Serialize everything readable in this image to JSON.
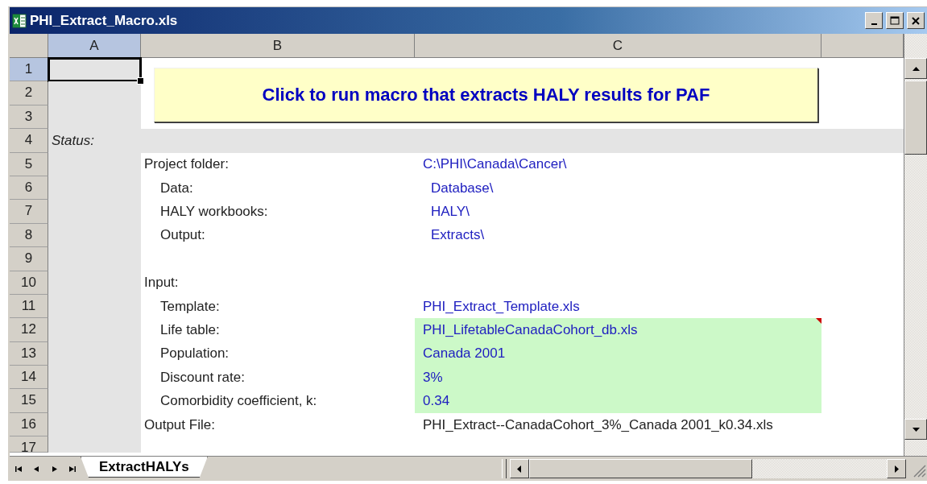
{
  "window": {
    "title": "PHI_Extract_Macro.xls"
  },
  "columns": [
    {
      "label": "A",
      "selected": true
    },
    {
      "label": "B",
      "selected": false
    },
    {
      "label": "C",
      "selected": false
    }
  ],
  "macro_button": {
    "label": "Click to run macro that extracts HALY results for PAF"
  },
  "rows": [
    {
      "number": "1",
      "selected": true
    },
    {
      "number": "2",
      "selected": false
    },
    {
      "number": "3",
      "selected": false
    },
    {
      "number": "4",
      "selected": false,
      "status": "Status:"
    },
    {
      "number": "5",
      "selected": false,
      "label": "Project folder:",
      "indented": false,
      "value": "C:\\PHI\\Canada\\Cancer\\",
      "kind": "path"
    },
    {
      "number": "6",
      "selected": false,
      "label": "Data:",
      "indented": true,
      "value": "Database\\",
      "kind": "subpath"
    },
    {
      "number": "7",
      "selected": false,
      "label": "HALY workbooks:",
      "indented": true,
      "value": "HALY\\",
      "kind": "subpath"
    },
    {
      "number": "8",
      "selected": false,
      "label": "Output:",
      "indented": true,
      "value": "Extracts\\",
      "kind": "subpath"
    },
    {
      "number": "9",
      "selected": false
    },
    {
      "number": "10",
      "selected": false,
      "label": "Input:",
      "indented": false
    },
    {
      "number": "11",
      "selected": false,
      "label": "Template:",
      "indented": true,
      "value": "PHI_Extract_Template.xls",
      "kind": "path"
    },
    {
      "number": "12",
      "selected": false,
      "label": "Life table:",
      "indented": true,
      "value": "PHI_LifetableCanadaCohort_db.xls",
      "kind": "input",
      "has_comment": true
    },
    {
      "number": "13",
      "selected": false,
      "label": "Population:",
      "indented": true,
      "value": "Canada 2001",
      "kind": "input"
    },
    {
      "number": "14",
      "selected": false,
      "label": "Discount rate:",
      "indented": true,
      "value": "3%",
      "kind": "input"
    },
    {
      "number": "15",
      "selected": false,
      "label": "Comorbidity coefficient, k:",
      "indented": true,
      "value": "0.34",
      "kind": "input"
    },
    {
      "number": "16",
      "selected": false,
      "label": "Output File:",
      "indented": false,
      "value": "PHI_Extract--CanadaCohort_3%_Canada 2001_k0.34.xls",
      "kind": "result"
    },
    {
      "number": "17",
      "selected": false
    }
  ],
  "sheet_tabs": [
    {
      "label": "ExtractHALYs",
      "selected": true
    }
  ]
}
